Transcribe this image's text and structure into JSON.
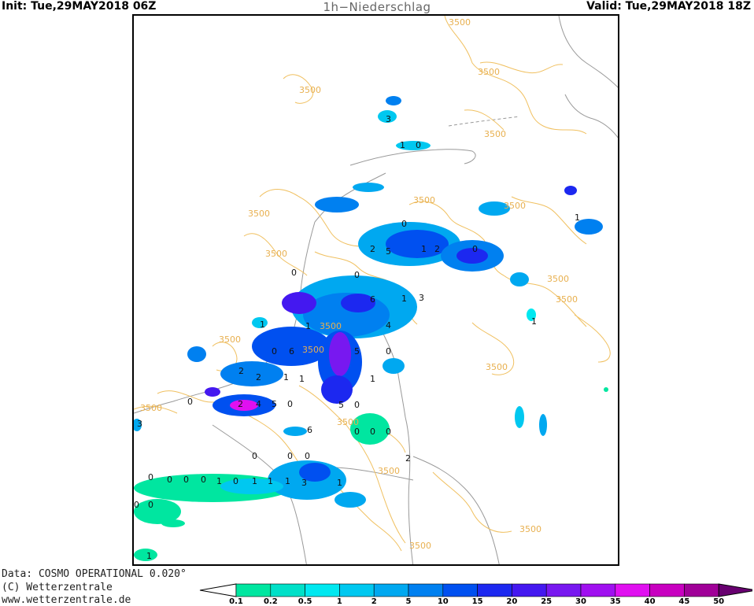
{
  "header": {
    "init": "Init: Tue,29MAY2018 06Z",
    "title": "1h−Niederschlag",
    "valid": "Valid: Tue,29MAY2018 18Z"
  },
  "footer": {
    "line1": "Data: COSMO OPERATIONAL 0.020°",
    "line2": "(C) Wetterzentrale",
    "line3": "www.wetterzentrale.de"
  },
  "map": {
    "contour_label": "3500",
    "cell_labels": [
      "0",
      "1",
      "2",
      "3",
      "4",
      "5",
      "6"
    ]
  },
  "colorbar": {
    "labels": [
      "0.1",
      "0.2",
      "0.5",
      "1",
      "2",
      "5",
      "10",
      "15",
      "20",
      "25",
      "30",
      "35",
      "40",
      "45",
      "50"
    ],
    "colors": [
      "#00e6a0",
      "#00e0c8",
      "#00e8f0",
      "#00c8f0",
      "#00a8f0",
      "#0080f0",
      "#0050f0",
      "#1c28f0",
      "#4418f0",
      "#7818f0",
      "#a010f0",
      "#e010f0",
      "#c800c0",
      "#a00098"
    ]
  },
  "colors": {
    "contour": "#f0c060",
    "border": "#999999"
  }
}
